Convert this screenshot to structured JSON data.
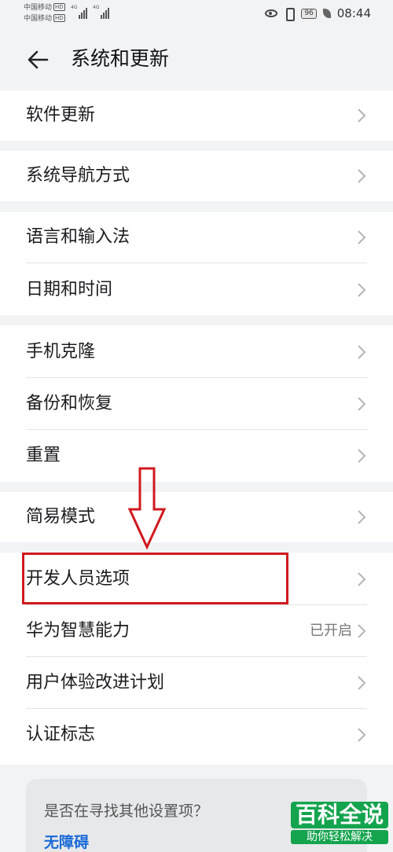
{
  "status_bar": {
    "carrier1": "中国移动",
    "carrier2": "中国移动",
    "hd": "HD",
    "net1": "4G",
    "net2": "4G",
    "battery": "96",
    "time": "08:44"
  },
  "header": {
    "back_icon": "arrow-left-icon",
    "title": "系统和更新"
  },
  "items": [
    {
      "label": "软件更新"
    },
    {
      "label": "系统导航方式"
    },
    {
      "label": "语言和输入法"
    },
    {
      "label": "日期和时间"
    },
    {
      "label": "手机克隆"
    },
    {
      "label": "备份和恢复"
    },
    {
      "label": "重置"
    },
    {
      "label": "简易模式"
    },
    {
      "label": "开发人员选项"
    },
    {
      "label": "华为智慧能力",
      "value": "已开启"
    },
    {
      "label": "用户体验改进计划"
    },
    {
      "label": "认证标志"
    }
  ],
  "suggestion": {
    "question": "是否在寻找其他设置项？",
    "link": "无障碍"
  },
  "annotation": {
    "arrow_icon": "down-arrow-annotation-icon",
    "highlight_color": "#d0191e"
  },
  "watermark": {
    "top": "百科全说",
    "bottom": "助你轻松解决"
  },
  "colors": {
    "background": "#f1f3f5",
    "card": "#ffffff",
    "link": "#1a6ad8"
  }
}
